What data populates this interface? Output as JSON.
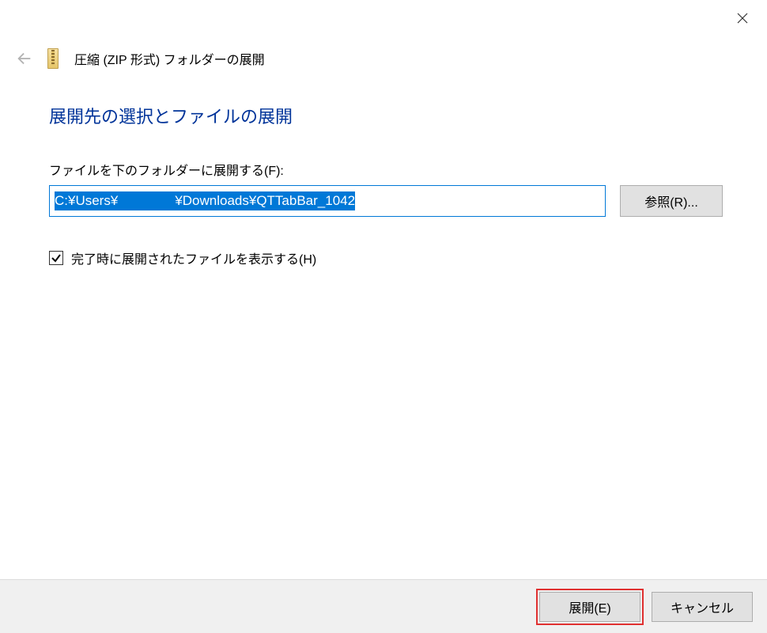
{
  "window": {
    "title": "圧縮 (ZIP 形式) フォルダーの展開"
  },
  "heading": "展開先の選択とファイルの展開",
  "path": {
    "label": "ファイルを下のフォルダーに展開する(F):",
    "value_prefix": "C:¥Users¥",
    "value_suffix": "¥Downloads¥QTTabBar_1042"
  },
  "browse_button": "参照(R)...",
  "checkbox": {
    "checked": true,
    "label": "完了時に展開されたファイルを表示する(H)"
  },
  "footer": {
    "extract": "展開(E)",
    "cancel": "キャンセル"
  }
}
